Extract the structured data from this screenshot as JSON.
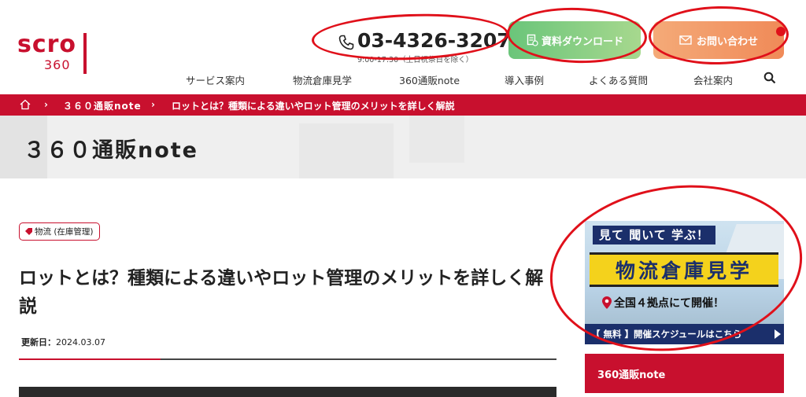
{
  "header": {
    "logo_top": "scro",
    "logo_sub": "360",
    "phone_number": "03-4326-3207",
    "phone_hours": "9:00-17:30（土日祝祭日を除く）",
    "download_label": "資料ダウンロード",
    "contact_label": "お問い合わせ"
  },
  "nav": {
    "items": [
      {
        "label": "サービス案内"
      },
      {
        "label": "物流倉庫見学"
      },
      {
        "label": "360通販note"
      },
      {
        "label": "導入事例"
      },
      {
        "label": "よくある質問"
      },
      {
        "label": "会社案内"
      }
    ]
  },
  "breadcrumb": {
    "sep": "›",
    "items": [
      {
        "label": "３６０通販note"
      },
      {
        "label": "ロットとは？種類による違いやロット管理のメリットを詳しく解説"
      }
    ]
  },
  "page_band": {
    "title": "３６０通販note"
  },
  "article": {
    "category": "物流 (在庫管理)",
    "title": "ロットとは？種類による違いやロット管理のメリットを詳しく解説",
    "updated_label": "更新日：",
    "updated_date": "2024.03.07"
  },
  "sidebar": {
    "banner": {
      "headline": "見て 聞いて 学ぶ！",
      "main": "物流倉庫見学",
      "location": "全国４拠点にて開催！",
      "footer": "【 無料 】開催スケジュールはこちら"
    },
    "note_box_label": "360通販note"
  },
  "colors": {
    "brand_red": "#c8102e",
    "download_green": "#6ac57a",
    "contact_orange": "#f08a58",
    "banner_navy": "#1b2f6b",
    "banner_yellow": "#f4d21c",
    "annotation_red": "#e0101a"
  }
}
